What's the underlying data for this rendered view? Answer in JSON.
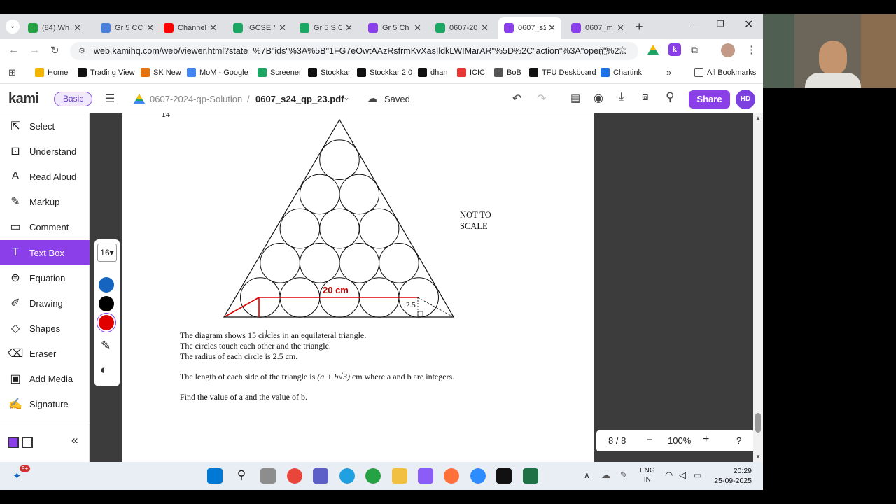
{
  "browser": {
    "tabs": [
      {
        "label": "(84) Wh",
        "color": "#25a244"
      },
      {
        "label": "Gr 5 CC",
        "color": "#4a7fd6"
      },
      {
        "label": "Channel",
        "color": "#ff0000"
      },
      {
        "label": "IGCSE M",
        "color": "#1fa463"
      },
      {
        "label": "Gr 5 S C",
        "color": "#1fa463"
      },
      {
        "label": "Gr 5 Ch",
        "color": "#8b3fe8"
      },
      {
        "label": "0607-20",
        "color": "#1fa463"
      },
      {
        "label": "0607_s2",
        "color": "#8b3fe8"
      },
      {
        "label": "0607_m",
        "color": "#8b3fe8"
      }
    ],
    "url": "web.kamihq.com/web/viewer.html?state=%7B\"ids\"%3A%5B\"1FG7eOwtAAzRsfrmKvXasIldkLWIMarAR\"%5D%2C\"action\"%3A\"open\"%2...",
    "bookmarks": [
      "Home",
      "Trading View",
      "SK New",
      "MoM - Google",
      "Screener",
      "Stockkar",
      "Stockkar 2.0",
      "dhan",
      "ICICI",
      "BoB",
      "TFU Deskboard",
      "Chartink"
    ],
    "all_bookmarks": "All Bookmarks"
  },
  "kami": {
    "logo": "kami",
    "plan": "Basic",
    "folder": "0607-2024-qp-Solution",
    "separator": "/",
    "filename": "0607_s24_qp_23.pdf",
    "saved": "Saved",
    "share": "Share",
    "user_initials": "HD"
  },
  "tools": [
    {
      "label": "Select",
      "icon": "select-cursor-icon"
    },
    {
      "label": "Understand",
      "icon": "understand-icon"
    },
    {
      "label": "Read Aloud",
      "icon": "read-aloud-icon"
    },
    {
      "label": "Markup",
      "icon": "markup-icon"
    },
    {
      "label": "Comment",
      "icon": "comment-icon"
    },
    {
      "label": "Text Box",
      "icon": "text-box-icon",
      "active": true
    },
    {
      "label": "Equation",
      "icon": "equation-icon"
    },
    {
      "label": "Drawing",
      "icon": "drawing-icon"
    },
    {
      "label": "Shapes",
      "icon": "shapes-icon"
    },
    {
      "label": "Eraser",
      "icon": "eraser-icon"
    },
    {
      "label": "Add Media",
      "icon": "add-media-icon"
    },
    {
      "label": "Signature",
      "icon": "signature-icon"
    }
  ],
  "palette": {
    "font_size": "16",
    "colors": [
      "#1565c0",
      "#000000",
      "#e00000"
    ],
    "selected": "#e00000"
  },
  "document": {
    "question_number": "14",
    "not_to_scale": [
      "NOT TO",
      "SCALE"
    ],
    "annotation_label": "20 cm",
    "radius_label": "2.5",
    "lines": [
      "The diagram shows 15 circles in an equilateral triangle.",
      "The circles touch each other and the triangle.",
      "The radius of each circle is 2.5 cm."
    ],
    "length_prefix": "The length of each side of the triangle is ",
    "length_expr": "(a + b√3)",
    "length_suffix": " cm where a and b are integers.",
    "find_line": "Find the value of a and the value of b."
  },
  "pager": {
    "page": "8 / 8",
    "zoom": "100%",
    "help": "?"
  },
  "taskbar": {
    "lang": "ENG",
    "region": "IN",
    "time": "20:29",
    "date": "25-09-2025",
    "badge": "9+"
  }
}
